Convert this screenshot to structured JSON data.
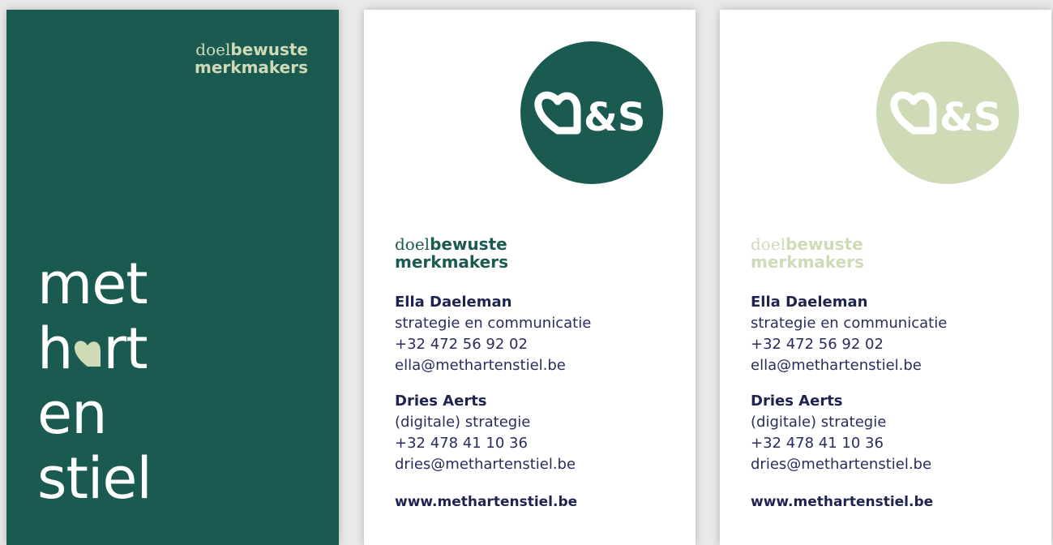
{
  "colors": {
    "dark_green": "#1a5a51",
    "light_green": "#cfdbb7",
    "navy": "#1f2350",
    "white": "#ffffff"
  },
  "tagline": {
    "light": "doel",
    "bold": "bewuste",
    "line2": "merkmakers"
  },
  "brand_words": {
    "line1": "met",
    "line2_pre": "h",
    "line2_post": "rt",
    "line3": "en",
    "line4": "stiel"
  },
  "logo": {
    "text": "&S",
    "icon": "heart-a-icon"
  },
  "contacts": [
    {
      "name": "Ella Daeleman",
      "role": "strategie en communicatie",
      "phone": "+32 472 56 92 02",
      "email": "ella@methartenstiel.be"
    },
    {
      "name": "Dries Aerts",
      "role": "(digitale) strategie",
      "phone": "+32 478 41 10 36",
      "email": "dries@methartenstiel.be"
    }
  ],
  "website": "www.methartenstiel.be"
}
